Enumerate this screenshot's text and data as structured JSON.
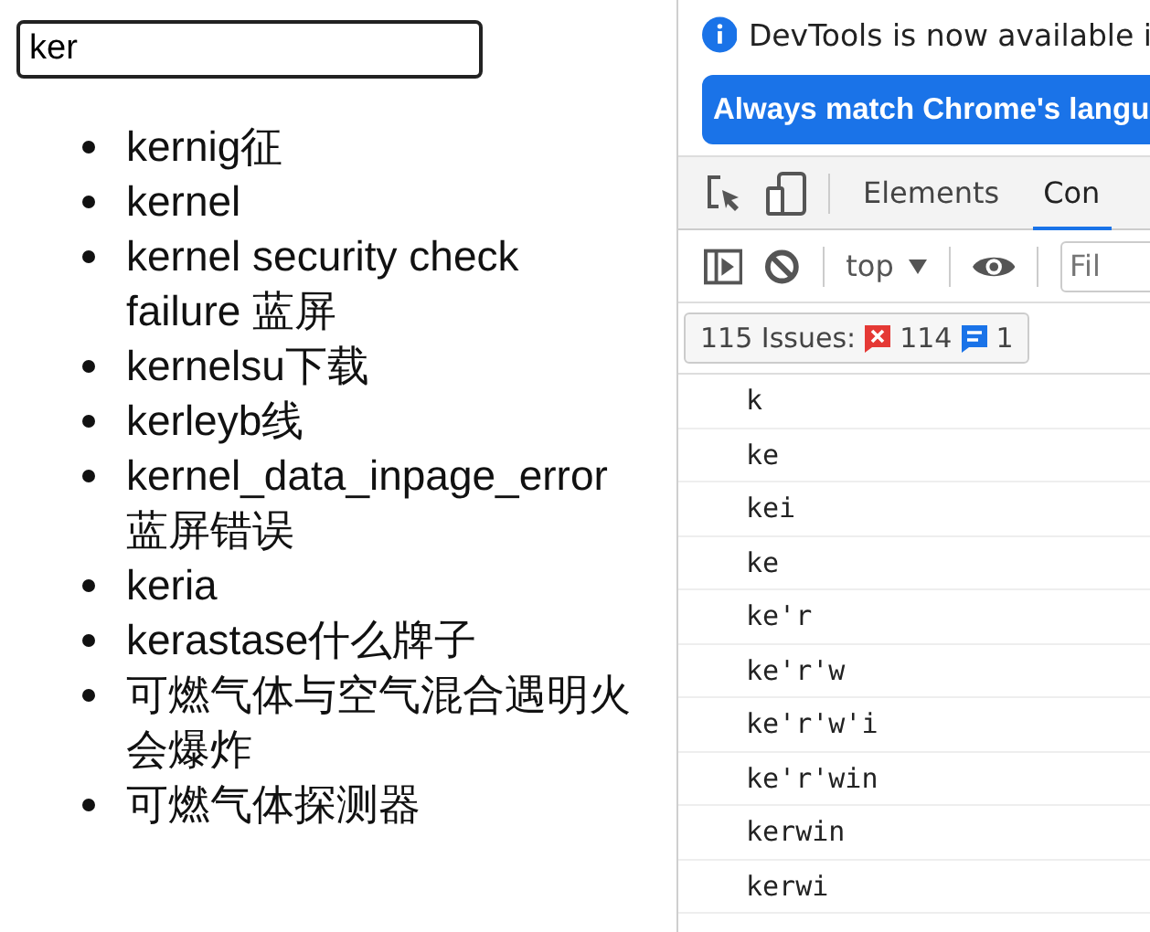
{
  "search": {
    "value": "ker"
  },
  "suggestions": [
    "kernig征",
    "kernel",
    "kernel security check failure 蓝屏",
    "kernelsu下载",
    "kerleyb线",
    "kernel_data_inpage_error 蓝屏错误",
    "keria",
    "kerastase什么牌子",
    "可燃气体与空气混合遇明火会爆炸",
    "可燃气体探测器"
  ],
  "devtools": {
    "notice": "DevTools is now available i",
    "language_button": "Always match Chrome's langu",
    "tabs": [
      {
        "label": "Elements",
        "selected": false
      },
      {
        "label": "Con",
        "selected": true
      }
    ],
    "context": "top",
    "filter": {
      "placeholder": "Fil"
    },
    "issues": {
      "label": "115 Issues:",
      "errors": "114",
      "info": "1"
    },
    "console": [
      "k",
      "ke",
      "kei",
      "ke",
      "ke'r",
      "ke'r'w",
      "ke'r'w'i",
      "ke'r'win",
      "kerwin",
      "kerwi"
    ]
  }
}
